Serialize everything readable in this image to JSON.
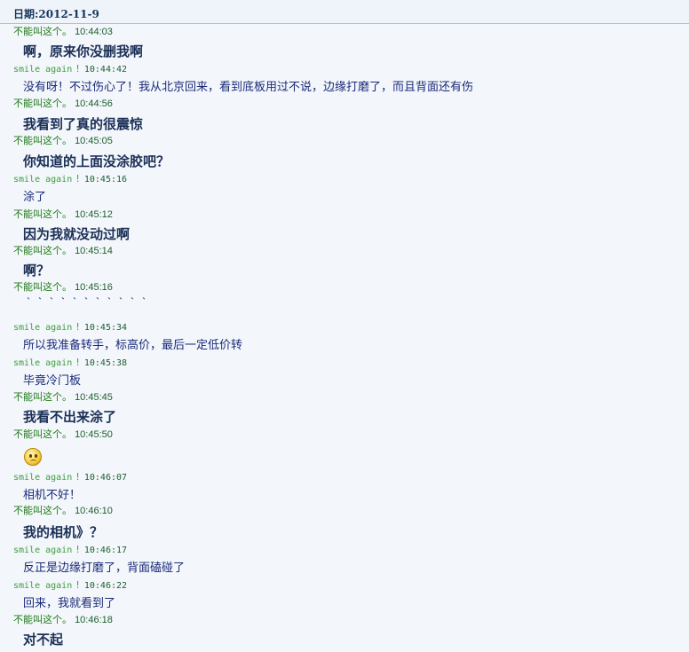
{
  "header": {
    "date": "日期:2012-11-9"
  },
  "users": {
    "a": "不能叫这个。",
    "b": "smile again"
  },
  "status_icon": "!",
  "messages": [
    {
      "sender": "不能叫这个。",
      "time": "10:44:03",
      "text": "啊，原来你没删我啊",
      "style": "big"
    },
    {
      "sender": "smile again",
      "time": "10:44:42",
      "text": "没有呀！不过伤心了！我从北京回来，看到底板用过不说，边缘打磨了，而且背面还有伤",
      "style": "small"
    },
    {
      "sender": "不能叫这个。",
      "time": "10:44:56",
      "text": "我看到了真的很震惊",
      "style": "big"
    },
    {
      "sender": "不能叫这个。",
      "time": "10:45:05",
      "text": "你知道的上面没涂胶吧？",
      "style": "big"
    },
    {
      "sender": "smile again",
      "time": "10:45:16",
      "text": "涂了",
      "style": "small"
    },
    {
      "sender": "不能叫这个。",
      "time": "10:45:12",
      "text": "因为我就没动过啊",
      "style": "big"
    },
    {
      "sender": "不能叫这个。",
      "time": "10:45:14",
      "text": "啊？",
      "style": "big"
    },
    {
      "sender": "不能叫这个。",
      "time": "10:45:16",
      "text": "｀｀｀｀｀｀｀｀｀｀｀",
      "style": "small"
    },
    {
      "sender": "smile again",
      "time": "10:45:34",
      "text": "所以我准备转手，标高价，最后一定低价转",
      "style": "small"
    },
    {
      "sender": "smile again",
      "time": "10:45:38",
      "text": "毕竟冷门板",
      "style": "small"
    },
    {
      "sender": "不能叫这个。",
      "time": "10:45:45",
      "text": "我看不出来涂了",
      "style": "big"
    },
    {
      "sender": "不能叫这个。",
      "time": "10:45:50",
      "text": "",
      "style": "emoji",
      "icon": "confused-face-emoji"
    },
    {
      "sender": "smile again",
      "time": "10:46:07",
      "text": "相机不好！",
      "style": "small"
    },
    {
      "sender": "不能叫这个。",
      "time": "10:46:10",
      "text": "我的相机》？",
      "style": "big"
    },
    {
      "sender": "smile again",
      "time": "10:46:17",
      "text": "反正是边缘打磨了，背面磕碰了",
      "style": "small"
    },
    {
      "sender": "smile again",
      "time": "10:46:22",
      "text": "回来，我就看到了",
      "style": "small"
    },
    {
      "sender": "不能叫这个。",
      "time": "10:46:18",
      "text": "对不起",
      "style": "big"
    }
  ]
}
